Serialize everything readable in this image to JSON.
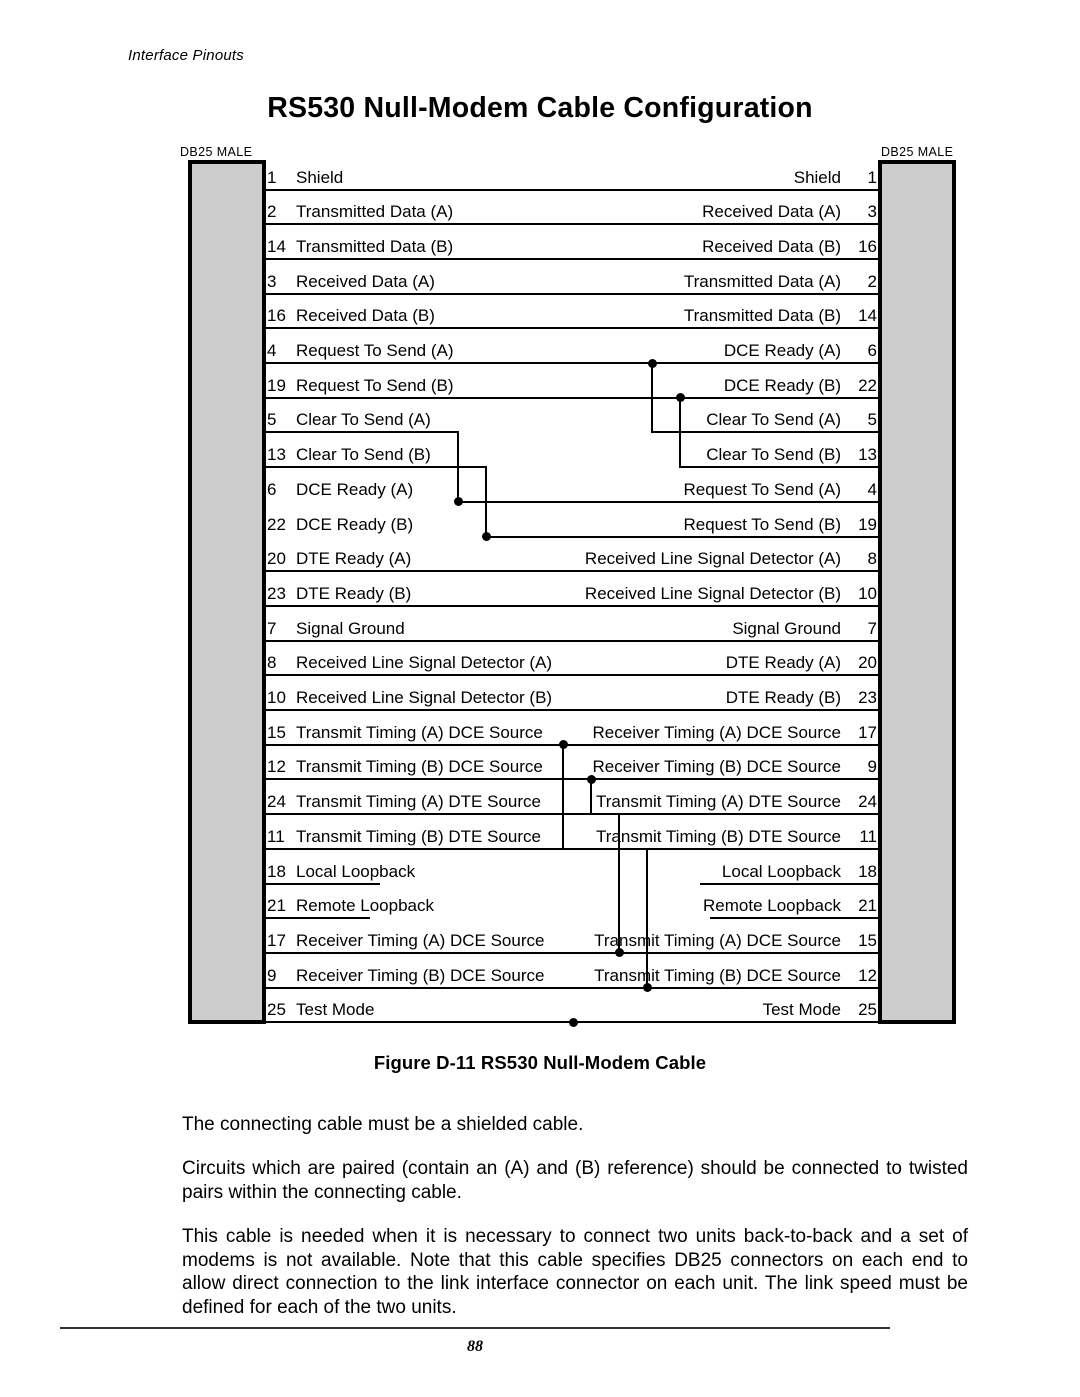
{
  "running_head": "Interface Pinouts",
  "page_title": "RS530 Null-Modem Cable Configuration",
  "figure": {
    "left_connector_label": "DB25 MALE",
    "right_connector_label": "DB25 MALE",
    "rows": [
      {
        "left_pin": "1",
        "left_label": "Shield",
        "right_label": "Shield",
        "right_pin": "1"
      },
      {
        "left_pin": "2",
        "left_label": "Transmitted Data (A)",
        "right_label": "Received Data (A)",
        "right_pin": "3"
      },
      {
        "left_pin": "14",
        "left_label": "Transmitted Data (B)",
        "right_label": "Received Data (B)",
        "right_pin": "16"
      },
      {
        "left_pin": "3",
        "left_label": "Received Data (A)",
        "right_label": "Transmitted Data (A)",
        "right_pin": "2"
      },
      {
        "left_pin": "16",
        "left_label": "Received Data (B)",
        "right_label": "Transmitted Data (B)",
        "right_pin": "14"
      },
      {
        "left_pin": "4",
        "left_label": "Request To Send (A)",
        "right_label": "DCE Ready (A)",
        "right_pin": "6"
      },
      {
        "left_pin": "19",
        "left_label": "Request To Send (B)",
        "right_label": "DCE Ready (B)",
        "right_pin": "22"
      },
      {
        "left_pin": "5",
        "left_label": "Clear To Send (A)",
        "right_label": "Clear To Send (A)",
        "right_pin": "5"
      },
      {
        "left_pin": "13",
        "left_label": "Clear To Send (B)",
        "right_label": "Clear To Send (B)",
        "right_pin": "13"
      },
      {
        "left_pin": "6",
        "left_label": "DCE Ready (A)",
        "right_label": "Request To Send (A)",
        "right_pin": "4"
      },
      {
        "left_pin": "22",
        "left_label": "DCE Ready (B)",
        "right_label": "Request To Send (B)",
        "right_pin": "19"
      },
      {
        "left_pin": "20",
        "left_label": "DTE Ready (A)",
        "right_label": "Received Line Signal Detector (A)",
        "right_pin": "8"
      },
      {
        "left_pin": "23",
        "left_label": "DTE Ready (B)",
        "right_label": "Received Line Signal Detector (B)",
        "right_pin": "10"
      },
      {
        "left_pin": "7",
        "left_label": "Signal Ground",
        "right_label": "Signal Ground",
        "right_pin": "7"
      },
      {
        "left_pin": "8",
        "left_label": "Received Line Signal Detector (A)",
        "right_label": "DTE Ready (A)",
        "right_pin": "20"
      },
      {
        "left_pin": "10",
        "left_label": "Received Line Signal Detector (B)",
        "right_label": "DTE Ready (B)",
        "right_pin": "23"
      },
      {
        "left_pin": "15",
        "left_label": "Transmit Timing (A) DCE Source",
        "right_label": "Receiver Timing (A) DCE Source",
        "right_pin": "17"
      },
      {
        "left_pin": "12",
        "left_label": "Transmit Timing (B) DCE Source",
        "right_label": "Receiver Timing (B) DCE Source",
        "right_pin": "9"
      },
      {
        "left_pin": "24",
        "left_label": "Transmit Timing (A) DTE Source",
        "right_label": "Transmit Timing (A) DTE Source",
        "right_pin": "24"
      },
      {
        "left_pin": "11",
        "left_label": "Transmit Timing (B) DTE Source",
        "right_label": "Transmit Timing (B) DTE Source",
        "right_pin": "11"
      },
      {
        "left_pin": "18",
        "left_label": "Local Loopback",
        "right_label": "Local Loopback",
        "right_pin": "18"
      },
      {
        "left_pin": "21",
        "left_label": "Remote Loopback",
        "right_label": "Remote Loopback",
        "right_pin": "21"
      },
      {
        "left_pin": "17",
        "left_label": "Receiver Timing (A) DCE Source",
        "right_label": "Transmit Timing (A) DCE Source",
        "right_pin": "15"
      },
      {
        "left_pin": "9",
        "left_label": "Receiver Timing (B) DCE Source",
        "right_label": "Transmit Timing (B) DCE Source",
        "right_pin": "12"
      },
      {
        "left_pin": "25",
        "left_label": "Test Mode",
        "right_label": "Test Mode",
        "right_pin": "25"
      }
    ]
  },
  "figure_caption": "Figure D-11 RS530 Null-Modem Cable",
  "paragraphs": {
    "p1": "The connecting cable must be a shielded cable.",
    "p2": "Circuits which are paired (contain an (A) and (B) reference) should be connected to twisted pairs within the connecting cable.",
    "p3": "This cable is needed when it is necessary to connect two units back-to-back and a set of modems is not available.  Note that this cable specifies DB25 connectors on each end to allow direct connection to the link interface connector on each unit.  The link speed must be defined for each of the two units."
  },
  "page_number": "88"
}
